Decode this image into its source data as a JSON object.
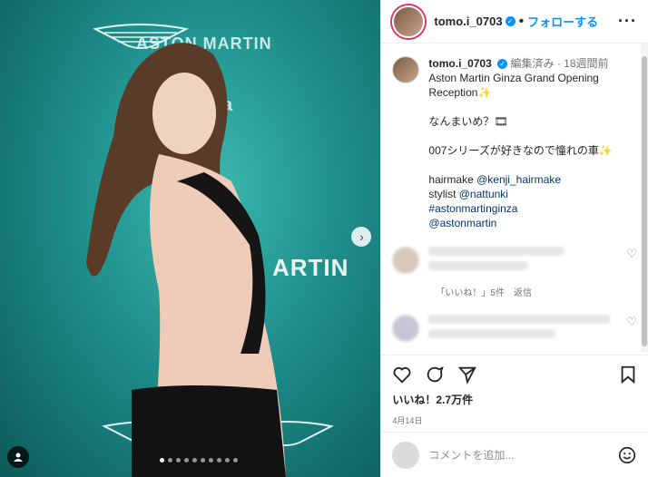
{
  "post": {
    "username": "tomo.i_0703",
    "follow_label": "フォローする",
    "edited": "編集済み",
    "age": "18週間前",
    "caption": [
      "Aston Martin Ginza Grand Opening Reception✨",
      "なんまいめ？🎞",
      "007シリーズが好きなので憧れの車✨"
    ],
    "credits": {
      "hairmake_label": "hairmake",
      "hairmake_link": "@kenji_hairmake",
      "stylist_label": "stylist",
      "stylist_link": "@nattunki",
      "tag1": "#astonmartinginza",
      "tag2": "@astonmartin"
    },
    "comment_meta": "「いいね！」5件　返信",
    "likes": "いいね！2.7万件",
    "date": "4月14日",
    "comment_placeholder": "コメントを追加..."
  },
  "photo": {
    "brand_top": "ASTON MARTIN",
    "brand_mid": "ARTIN",
    "brand_partial": "a",
    "dots_count": 10,
    "active_dot": 0
  },
  "icons": [
    "verified-icon",
    "more-icon",
    "heart-icon",
    "comment-icon",
    "share-icon",
    "save-icon",
    "emoji-icon",
    "next-arrow-icon",
    "tag-user-icon"
  ],
  "colors": {
    "accent": "#0095f6",
    "backdrop": "#1f8f8c"
  }
}
